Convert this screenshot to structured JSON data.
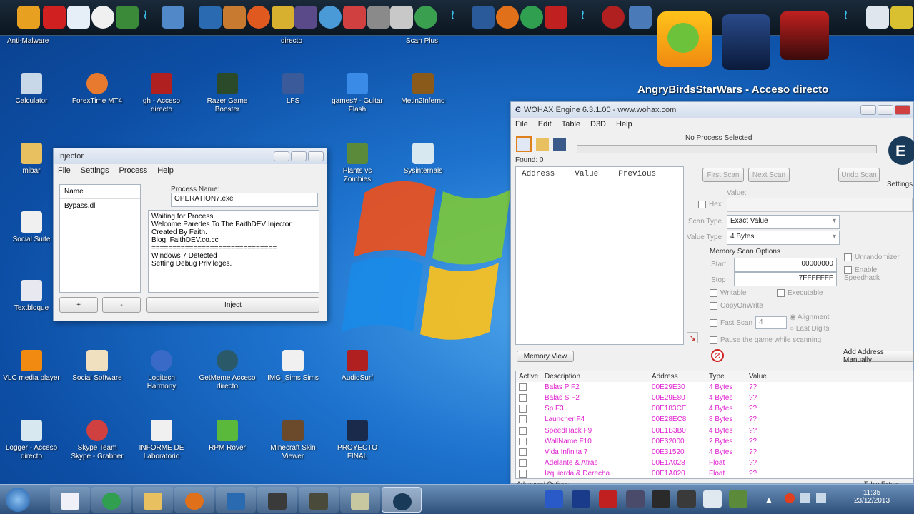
{
  "dock": {
    "label_antimalware": "Anti-Malware",
    "label_directo": "directo",
    "label_scanplus": "Scan Plus"
  },
  "desktop": {
    "shortcut_title": "AngryBirdsStarWars - Acceso directo",
    "icons": [
      {
        "label": "Calculator"
      },
      {
        "label": "ForexTime MT4"
      },
      {
        "label": "gh - Acceso directo"
      },
      {
        "label": "Razer Game Booster"
      },
      {
        "label": "LFS"
      },
      {
        "label": "games# - Guitar Flash"
      },
      {
        "label": "Metin2Inferno"
      },
      {
        "label": "mibar"
      },
      {
        "label": "Plants vs Zombies"
      },
      {
        "label": "Sysinternals"
      },
      {
        "label": "Social Suite"
      },
      {
        "label": "Textbloque"
      },
      {
        "label": "VLC media player"
      },
      {
        "label": "Social Software"
      },
      {
        "label": "Logitech Harmony"
      },
      {
        "label": "GetMeme Acceso directo"
      },
      {
        "label": "IMG_Sims Sims"
      },
      {
        "label": "AudioSurf"
      },
      {
        "label": "Logger - Acceso directo"
      },
      {
        "label": "Skype Team Skype - Grabber"
      },
      {
        "label": "INFORME DE Laboratorio"
      },
      {
        "label": "RPM Rover"
      },
      {
        "label": "Minecraft Skin Viewer"
      },
      {
        "label": "PROYECTO FINAL"
      }
    ]
  },
  "injector": {
    "title": "Injector",
    "menu": [
      "File",
      "Settings",
      "Process",
      "Help"
    ],
    "list_header": "Name",
    "list_items": [
      "Bypass.dll"
    ],
    "process_label": "Process Name:",
    "process_value": "OPERATION7.exe",
    "log": [
      "Waiting for Process",
      "Welcome Paredes To The FaithDEV Injector",
      "Created By Faith.",
      "Blog: FaithDEV.co.cc",
      "==============================",
      "Windows 7 Detected",
      "Setting Debug Privileges."
    ],
    "add_label": "+",
    "remove_label": "-",
    "inject_label": "Inject"
  },
  "cheatengine": {
    "title": "WOHAX Engine 6.3.1.00 - www.wohax.com",
    "menu": [
      "File",
      "Edit",
      "Table",
      "D3D",
      "Help"
    ],
    "process_status": "No Process Selected",
    "found": "Found: 0",
    "cols": [
      "Address",
      "Value",
      "Previous"
    ],
    "first_scan": "First Scan",
    "next_scan": "Next Scan",
    "undo_scan": "Undo Scan",
    "settings": "Settings",
    "value_label": "Value:",
    "hex_label": "Hex",
    "scan_type_label": "Scan Type",
    "scan_type_value": "Exact Value",
    "value_type_label": "Value Type",
    "value_type_value": "4 Bytes",
    "mem_options": "Memory Scan Options",
    "start_label": "Start",
    "start_value": "00000000",
    "stop_label": "Stop",
    "stop_value": "7FFFFFFF",
    "writable": "Writable",
    "executable": "Executable",
    "copyonwrite": "CopyOnWrite",
    "fastscan": "Fast Scan",
    "fastscan_value": "4",
    "alignment": "Alignment",
    "lastdigits": "Last Digits",
    "pause": "Pause the game while scanning",
    "unrandomizer": "Unrandomizer",
    "speedhack": "Enable Speedhack",
    "memory_view": "Memory View",
    "add_manual": "Add Address Manually",
    "table_cols": [
      "Active",
      "Description",
      "Address",
      "Type",
      "Value"
    ],
    "rows": [
      {
        "desc": "Balas P F2",
        "addr": "00E29E30",
        "type": "4 Bytes",
        "val": "??"
      },
      {
        "desc": "Balas S F2",
        "addr": "00E29E80",
        "type": "4 Bytes",
        "val": "??"
      },
      {
        "desc": "Sp F3",
        "addr": "00E183CE",
        "type": "4 Bytes",
        "val": "??"
      },
      {
        "desc": "Launcher F4",
        "addr": "00E28EC8",
        "type": "8 Bytes",
        "val": "??"
      },
      {
        "desc": "SpeedHack F9",
        "addr": "00E1B3B0",
        "type": "4 Bytes",
        "val": "??"
      },
      {
        "desc": "WallName F10",
        "addr": "00E32000",
        "type": "2 Bytes",
        "val": "??"
      },
      {
        "desc": "Vida Infinita 7",
        "addr": "00E31520",
        "type": "4 Bytes",
        "val": "??"
      },
      {
        "desc": "Adelante & Atras",
        "addr": "00E1A028",
        "type": "Float",
        "val": "??"
      },
      {
        "desc": "Izquierda & Derecha",
        "addr": "00E1A020",
        "type": "Float",
        "val": "??"
      }
    ],
    "adv_options": "Advanced Options",
    "table_extras": "Table Extras"
  },
  "taskbar": {
    "time": "11:35",
    "date": "23/12/2013"
  },
  "colors": {
    "cheat_pink": "#e020d0",
    "accent_blue": "#1e74cf"
  }
}
